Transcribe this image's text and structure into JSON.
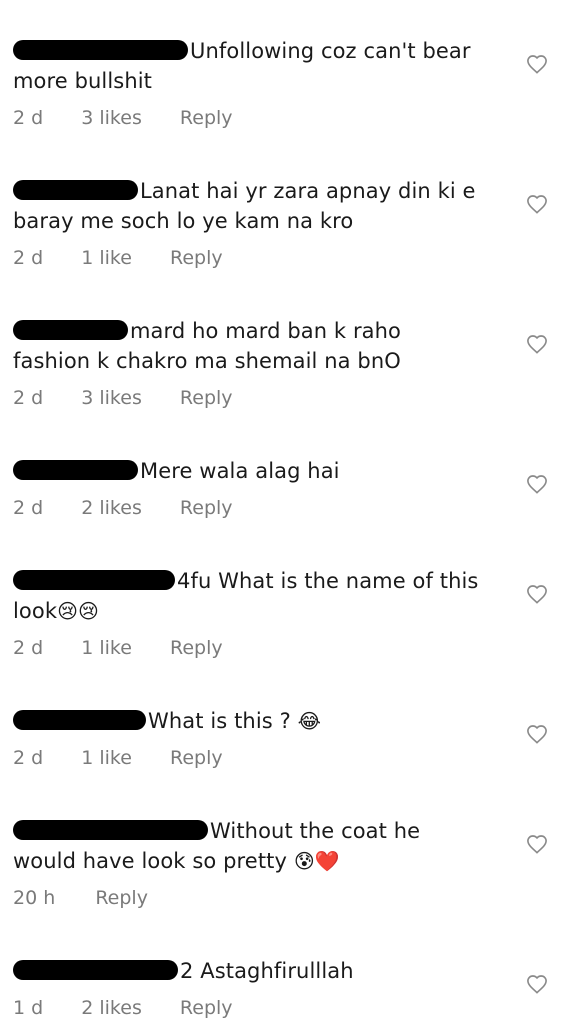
{
  "comments": [
    {
      "text_line1": "Unfollowing coz can't bear",
      "text_line2": "more bullshit",
      "time": "2 d",
      "likes": "3 likes",
      "reply": "Reply"
    },
    {
      "text_line1": "Lanat hai yr zara apnay din ki e",
      "text_line2": "baray me soch lo ye kam na kro",
      "time": "2 d",
      "likes": "1 like",
      "reply": "Reply"
    },
    {
      "text_line1": "mard ho mard ban k raho",
      "text_line2": "fashion k chakro ma shemail na bnO",
      "time": "2 d",
      "likes": "3 likes",
      "reply": "Reply"
    },
    {
      "text_line1": "Mere wala alag hai",
      "time": "2 d",
      "likes": "2 likes",
      "reply": "Reply"
    },
    {
      "username_partial": "4fu",
      "text_line1": "What is the name of this",
      "text_line2": "look",
      "emoji": "😢😢",
      "time": "2 d",
      "likes": "1 like",
      "reply": "Reply"
    },
    {
      "text_line1": "What is this ?",
      "emoji": "😂",
      "time": "2 d",
      "likes": "1 like",
      "reply": "Reply"
    },
    {
      "text_line1": "Without the coat he",
      "text_line2": "would have look so pretty",
      "emoji": "😰❤️",
      "time": "20 h",
      "reply": "Reply"
    },
    {
      "username_partial": "2",
      "text_line1": "Astaghfirulllah",
      "time": "1 d",
      "likes": "2 likes",
      "reply": "Reply"
    }
  ],
  "colors": {
    "text": "#1a1a1a",
    "meta": "#7a7a7a",
    "heart_outline": "#8a8a8a",
    "redaction": "#000000"
  },
  "icons": {
    "like": "heart-outline-icon"
  }
}
